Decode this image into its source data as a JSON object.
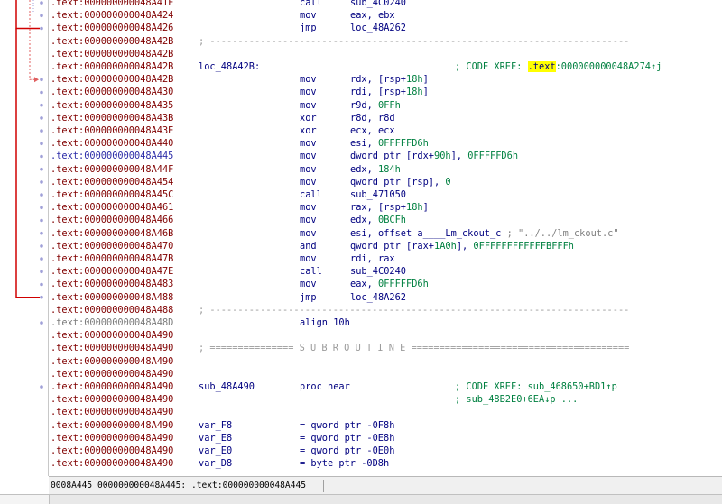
{
  "colors": {
    "segment": "#800000",
    "segment_selected": "#2c2ca8",
    "instruction": "#000080",
    "number": "#008040",
    "comment": "#808080",
    "xref": "#008040",
    "highlight": "#ffff00",
    "flow_arrow": "#d00000",
    "flow_dashed": "#e06060",
    "gutter_dot": "#a0a0d8"
  },
  "lines": [
    {
      "seg": ".text:000000000048A41F",
      "mn": "call",
      "op": [
        {
          "t": "sub_4C0240"
        }
      ]
    },
    {
      "seg": ".text:000000000048A424",
      "mn": "mov",
      "op": [
        {
          "t": "eax, ebx"
        }
      ]
    },
    {
      "seg": ".text:000000000048A426",
      "mn": "jmp",
      "op": [
        {
          "t": "loc_48A262"
        }
      ]
    },
    {
      "seg": ".text:000000000048A42B",
      "sep": "; ---------------------------------------------------------------------------"
    },
    {
      "seg": ".text:000000000048A42B"
    },
    {
      "seg": ".text:000000000048A42B",
      "lbl": "loc_48A42B:",
      "xref": {
        "pre": "; CODE XREF: ",
        "hl": ".text",
        "post": ":000000000048A274↑j"
      }
    },
    {
      "seg": ".text:000000000048A42B",
      "mn": "mov",
      "op": [
        {
          "t": "rdx, [rsp+"
        },
        {
          "t": "18h",
          "c": "num"
        },
        {
          "t": "]"
        }
      ]
    },
    {
      "seg": ".text:000000000048A430",
      "mn": "mov",
      "op": [
        {
          "t": "rdi, [rsp+"
        },
        {
          "t": "18h",
          "c": "num"
        },
        {
          "t": "]"
        }
      ]
    },
    {
      "seg": ".text:000000000048A435",
      "mn": "mov",
      "op": [
        {
          "t": "r9d, "
        },
        {
          "t": "0FFh",
          "c": "num"
        }
      ]
    },
    {
      "seg": ".text:000000000048A43B",
      "mn": "xor",
      "op": [
        {
          "t": "r8d, r8d"
        }
      ]
    },
    {
      "seg": ".text:000000000048A43E",
      "mn": "xor",
      "op": [
        {
          "t": "ecx, ecx"
        }
      ]
    },
    {
      "seg": ".text:000000000048A440",
      "mn": "mov",
      "op": [
        {
          "t": "esi, "
        },
        {
          "t": "0FFFFFD6h",
          "c": "num"
        }
      ]
    },
    {
      "seg": ".text:000000000048A445",
      "sel": true,
      "mn": "mov",
      "op": [
        {
          "t": "dword ptr [rdx+"
        },
        {
          "t": "90h",
          "c": "num"
        },
        {
          "t": "], "
        },
        {
          "t": "0FFFFFD6h",
          "c": "num"
        }
      ]
    },
    {
      "seg": ".text:000000000048A44F",
      "mn": "mov",
      "op": [
        {
          "t": "edx, "
        },
        {
          "t": "184h",
          "c": "num"
        }
      ]
    },
    {
      "seg": ".text:000000000048A454",
      "mn": "mov",
      "op": [
        {
          "t": "qword ptr [rsp], "
        },
        {
          "t": "0",
          "c": "num"
        }
      ]
    },
    {
      "seg": ".text:000000000048A45C",
      "mn": "call",
      "op": [
        {
          "t": "sub_471050"
        }
      ]
    },
    {
      "seg": ".text:000000000048A461",
      "mn": "mov",
      "op": [
        {
          "t": "rax, [rsp+"
        },
        {
          "t": "18h",
          "c": "num"
        },
        {
          "t": "]"
        }
      ]
    },
    {
      "seg": ".text:000000000048A466",
      "mn": "mov",
      "op": [
        {
          "t": "edx, "
        },
        {
          "t": "0BCFh",
          "c": "num"
        }
      ]
    },
    {
      "seg": ".text:000000000048A46B",
      "mn": "mov",
      "op": [
        {
          "t": "esi, offset a____Lm_ckout_c "
        },
        {
          "t": "; \"../../lm_ckout.c\"",
          "c": "cmt"
        }
      ]
    },
    {
      "seg": ".text:000000000048A470",
      "mn": "and",
      "op": [
        {
          "t": "qword ptr [rax+"
        },
        {
          "t": "1A0h",
          "c": "num"
        },
        {
          "t": "], "
        },
        {
          "t": "0FFFFFFFFFFFFBFFFh",
          "c": "num"
        }
      ]
    },
    {
      "seg": ".text:000000000048A47B",
      "mn": "mov",
      "op": [
        {
          "t": "rdi, rax"
        }
      ]
    },
    {
      "seg": ".text:000000000048A47E",
      "mn": "call",
      "op": [
        {
          "t": "sub_4C0240"
        }
      ]
    },
    {
      "seg": ".text:000000000048A483",
      "mn": "mov",
      "op": [
        {
          "t": "eax, "
        },
        {
          "t": "0FFFFFD6h",
          "c": "num"
        }
      ]
    },
    {
      "seg": ".text:000000000048A488",
      "mn": "jmp",
      "op": [
        {
          "t": "loc_48A262"
        }
      ]
    },
    {
      "seg": ".text:000000000048A488",
      "sep": "; ---------------------------------------------------------------------------"
    },
    {
      "seg": ".text:000000000048A48D",
      "grey": true,
      "align": "align 10h"
    },
    {
      "seg": ".text:000000000048A490"
    },
    {
      "seg": ".text:000000000048A490",
      "sep": "; =============== S U B R O U T I N E ======================================="
    },
    {
      "seg": ".text:000000000048A490"
    },
    {
      "seg": ".text:000000000048A490"
    },
    {
      "seg": ".text:000000000048A490",
      "lbl": "sub_48A490",
      "mn": "proc near",
      "xref": {
        "pre": "; CODE XREF: sub_468650+BD1↑p",
        "hl": "",
        "post": ""
      }
    },
    {
      "seg": ".text:000000000048A490",
      "xref": {
        "pre": "; sub_48B2E0+6EA↓p ...",
        "hl": "",
        "post": ""
      }
    },
    {
      "seg": ".text:000000000048A490"
    },
    {
      "seg": ".text:000000000048A490",
      "dvar": "var_F8",
      "deq": "= qword ptr -0F8h"
    },
    {
      "seg": ".text:000000000048A490",
      "dvar": "var_E8",
      "deq": "= qword ptr -0E8h"
    },
    {
      "seg": ".text:000000000048A490",
      "dvar": "var_E0",
      "deq": "= qword ptr -0E0h"
    },
    {
      "seg": ".text:000000000048A490",
      "dvar": "var_D8",
      "deq": "= byte ptr -0D8h"
    }
  ],
  "status": {
    "text": "0008A445 000000000048A445: .text:000000000048A445"
  }
}
